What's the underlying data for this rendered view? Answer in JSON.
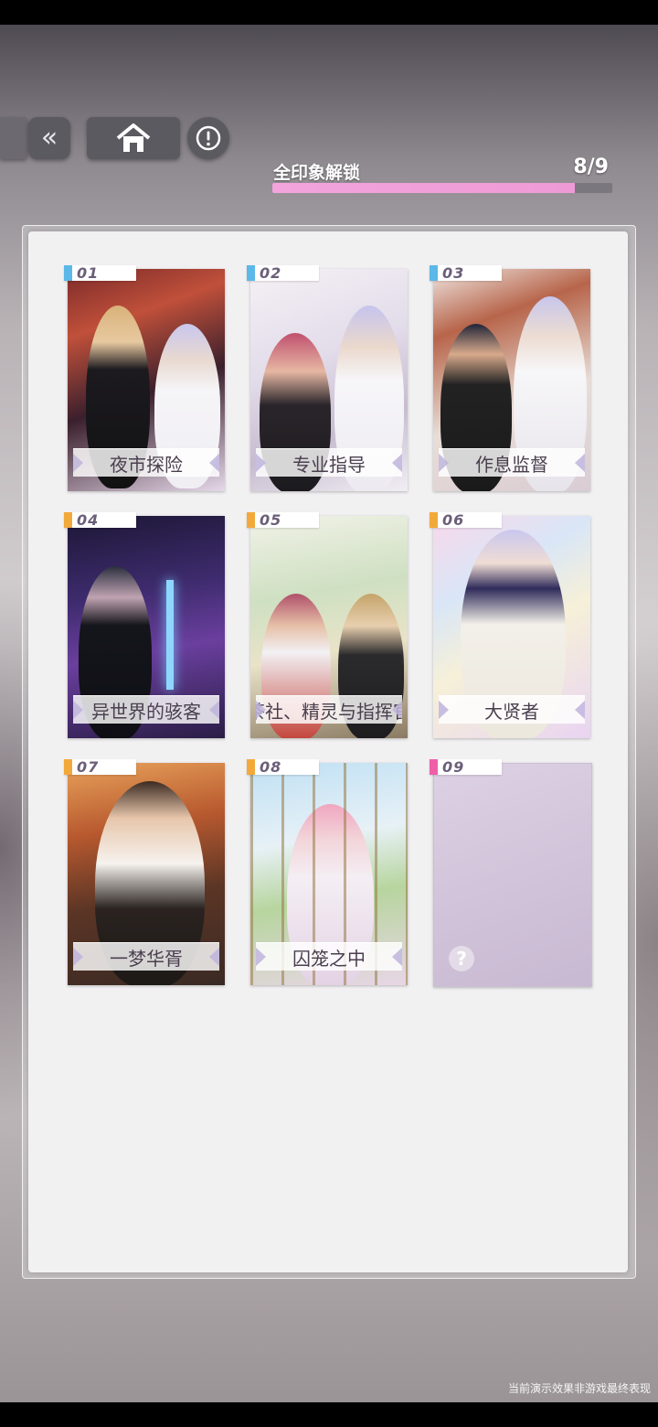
{
  "progress": {
    "label": "全印象解锁",
    "count": "8/9",
    "unlocked": 8,
    "total": 9,
    "fraction": 0.889
  },
  "nav": {
    "back_icon": "chevrons-left-icon",
    "home_icon": "home-icon",
    "info_icon": "exclamation-circle-icon"
  },
  "cards": [
    {
      "number": "01",
      "title": "夜市探险",
      "tag_color": "#5bb8e8",
      "locked": false
    },
    {
      "number": "02",
      "title": "专业指导",
      "tag_color": "#5bb8e8",
      "locked": false
    },
    {
      "number": "03",
      "title": "作息监督",
      "tag_color": "#5bb8e8",
      "locked": false
    },
    {
      "number": "04",
      "title": "异世界的骇客",
      "tag_color": "#f2a93b",
      "locked": false
    },
    {
      "number": "05",
      "title": "茶社、精灵与指挥官",
      "tag_color": "#f2a93b",
      "locked": false
    },
    {
      "number": "06",
      "title": "大贤者",
      "tag_color": "#f2a93b",
      "locked": false
    },
    {
      "number": "07",
      "title": "一梦华胥",
      "tag_color": "#f2a93b",
      "locked": false
    },
    {
      "number": "08",
      "title": "囚笼之中",
      "tag_color": "#f2a93b",
      "locked": false
    },
    {
      "number": "09",
      "title": "",
      "tag_color": "#ef5fa8",
      "locked": true,
      "lock_mark": "?"
    }
  ],
  "footer": {
    "disclaimer": "当前演示效果非游戏最终表现"
  }
}
